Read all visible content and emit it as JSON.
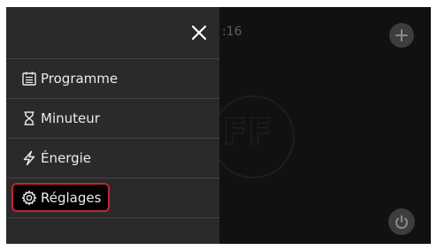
{
  "background": {
    "time_fragment": ":16",
    "plus_icon": "plus-icon",
    "power_icon": "power-icon"
  },
  "menu": {
    "close_icon": "close-icon",
    "items": [
      {
        "label": "Programme",
        "icon": "calendar-icon"
      },
      {
        "label": "Minuteur",
        "icon": "hourglass-icon"
      },
      {
        "label": "Énergie",
        "icon": "lightning-icon"
      },
      {
        "label": "Réglages",
        "icon": "gear-icon",
        "highlighted": true
      }
    ]
  },
  "colors": {
    "screen_bg": "#111111",
    "menu_bg": "#2a2a2a",
    "highlight": "#c6232f"
  }
}
